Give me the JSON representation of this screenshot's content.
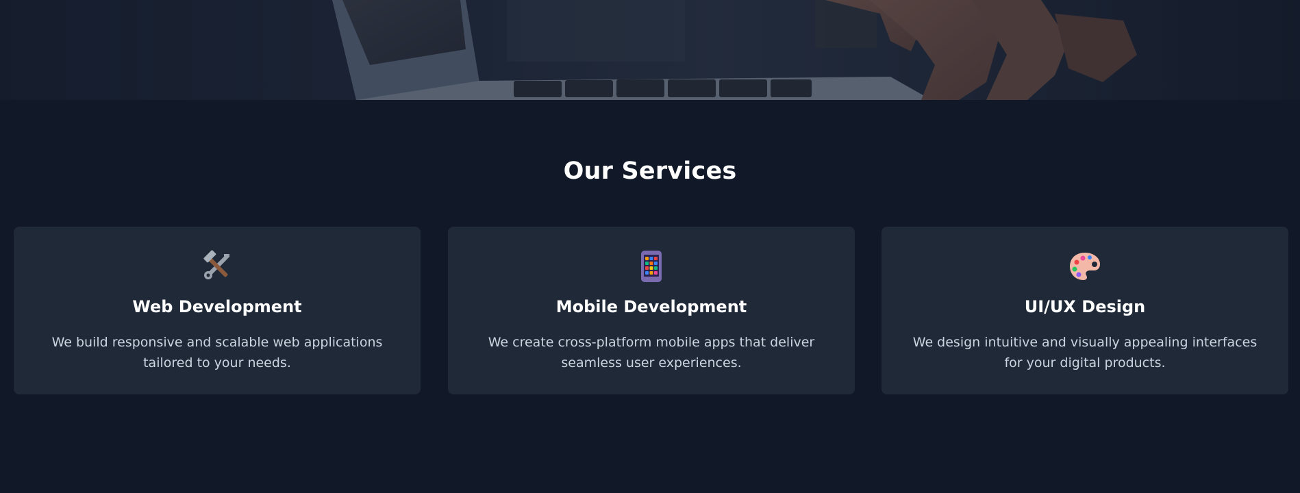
{
  "hero": {
    "image": "laptop-photo"
  },
  "services": {
    "title": "Our Services",
    "items": [
      {
        "icon": "hammer-wrench-icon",
        "title": "Web Development",
        "description": "We build responsive and scalable web applications tailored to your needs."
      },
      {
        "icon": "mobile-phone-icon",
        "title": "Mobile Development",
        "description": "We create cross-platform mobile apps that deliver seamless user experiences."
      },
      {
        "icon": "artist-palette-icon",
        "title": "UI/UX Design",
        "description": "We design intuitive and visually appealing interfaces for your digital products."
      }
    ]
  },
  "colors": {
    "page_background": "#111827",
    "card_background": "#1f2937",
    "heading_text": "#ffffff",
    "body_text": "#cbd5e1"
  }
}
